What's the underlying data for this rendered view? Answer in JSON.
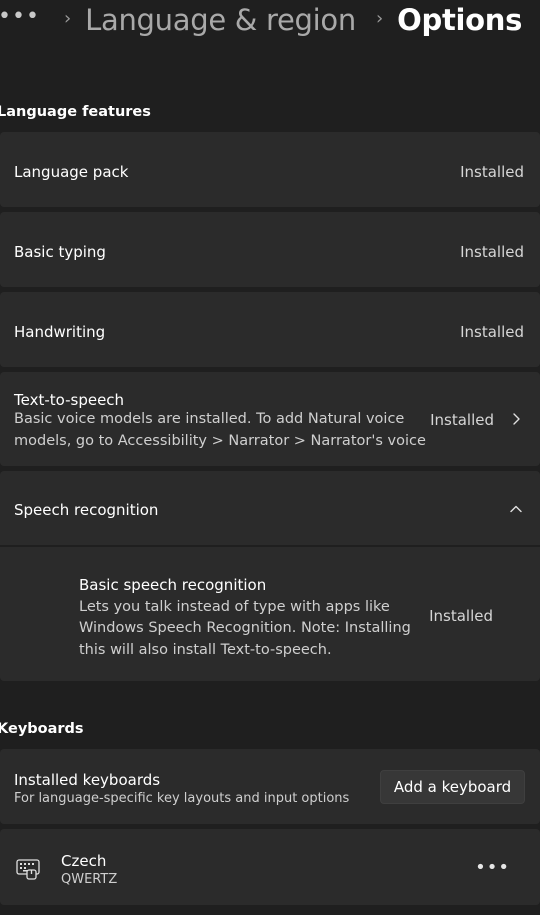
{
  "breadcrumb": {
    "overflow": "•••",
    "items": [
      "Language & region"
    ],
    "current": "Options"
  },
  "language_features": {
    "title": "Language features",
    "rows": [
      {
        "label": "Language pack",
        "status": "Installed"
      },
      {
        "label": "Basic typing",
        "status": "Installed"
      },
      {
        "label": "Handwriting",
        "status": "Installed"
      }
    ],
    "tts": {
      "label": "Text-to-speech",
      "description_line1": "Basic voice models are installed. To add Natural voice",
      "description_line2": "models, go to Accessibility > Narrator > Narrator's voice",
      "status": "Installed"
    },
    "speech": {
      "label": "Speech recognition",
      "child": {
        "label": "Basic speech recognition",
        "line1": "Lets you talk instead of type with apps like",
        "line2": "Windows Speech Recognition. Note: Installing",
        "line3": "this will also install Text-to-speech.",
        "status": "Installed"
      }
    }
  },
  "keyboards": {
    "title": "Keyboards",
    "installed": {
      "label": "Installed keyboards",
      "sublabel": "For language-specific key layouts and input options",
      "button": "Add a keyboard"
    },
    "items": [
      {
        "name": "Czech",
        "layout": "QWERTZ",
        "menu": "•••"
      }
    ]
  }
}
